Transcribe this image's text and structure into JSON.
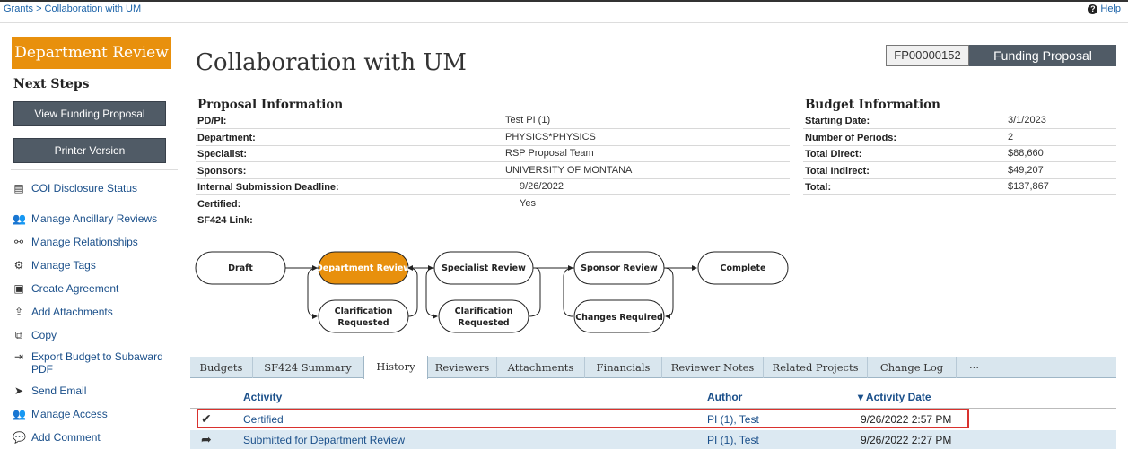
{
  "breadcrumb": "Grants > Collaboration with UM",
  "help_label": "Help",
  "sidebar": {
    "state": "Department Review",
    "next_steps_heading": "Next Steps",
    "buttons": [
      "View Funding Proposal",
      "Printer Version"
    ],
    "coi_link": "COI Disclosure Status",
    "activities": [
      "Manage Ancillary Reviews",
      "Manage Relationships",
      "Manage Tags",
      "Create Agreement",
      "Add Attachments",
      "Copy",
      "Export Budget to Subaward PDF",
      "Send Email",
      "Manage Access",
      "Add Comment"
    ]
  },
  "header": {
    "title": "Collaboration with UM",
    "id": "FP00000152",
    "type": "Funding Proposal"
  },
  "proposal_info": {
    "heading": "Proposal Information",
    "rows": [
      {
        "label": "PD/PI:",
        "value": "Test PI (1)"
      },
      {
        "label": "Department:",
        "value": "PHYSICS*PHYSICS"
      },
      {
        "label": "Specialist:",
        "value": "RSP Proposal Team"
      },
      {
        "label": "Sponsors:",
        "value": "UNIVERSITY OF MONTANA"
      },
      {
        "label": "Internal Submission Deadline:",
        "value": "9/26/2022"
      },
      {
        "label": "Certified:",
        "value": "Yes"
      },
      {
        "label": "SF424 Link:",
        "value": ""
      }
    ]
  },
  "budget_info": {
    "heading": "Budget Information",
    "rows": [
      {
        "label": "Starting Date:",
        "value": "3/1/2023"
      },
      {
        "label": "Number of Periods:",
        "value": "2"
      },
      {
        "label": "Total Direct:",
        "value": "$88,660"
      },
      {
        "label": "Total Indirect:",
        "value": "$49,207"
      },
      {
        "label": "Total:",
        "value": "$137,867"
      }
    ]
  },
  "workflow": {
    "states": [
      "Draft",
      "Department Review",
      "Specialist Review",
      "Sponsor Review",
      "Complete"
    ],
    "returns": [
      [
        "Clarification",
        "Requested"
      ],
      [
        "Clarification",
        "Requested"
      ],
      [
        "Changes Required"
      ]
    ],
    "current_color": "#e8900d"
  },
  "tabs": [
    "Budgets",
    "SF424 Summary",
    "History",
    "Reviewers",
    "Attachments",
    "Financials",
    "Reviewer Notes",
    "Related Projects",
    "Change Log",
    "···"
  ],
  "active_tab": "History",
  "history": {
    "columns": {
      "activity": "Activity",
      "author": "Author",
      "date": "▾ Activity Date"
    },
    "rows": [
      {
        "icon": "checkmark-icon",
        "activity": "Certified",
        "author": "PI (1), Test",
        "date": "9/26/2022 2:57 PM"
      },
      {
        "icon": "forward-arrow-icon",
        "activity": "Submitted for Department Review",
        "author": "PI (1), Test",
        "date": "9/26/2022 2:27 PM"
      }
    ]
  },
  "colors": {
    "accent": "#e8900d",
    "button": "#505b66",
    "link": "#1a4f8a",
    "highlight": "#d9322e"
  }
}
